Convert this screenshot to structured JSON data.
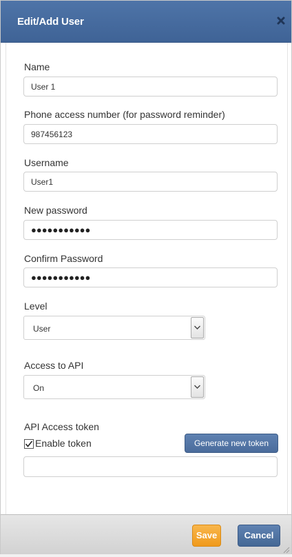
{
  "dialog": {
    "title": "Edit/Add User",
    "close_icon": "close-icon"
  },
  "form": {
    "name": {
      "label": "Name",
      "value": "User 1"
    },
    "phone": {
      "label": "Phone access number (for password reminder)",
      "value": "987456123"
    },
    "username": {
      "label": "Username",
      "value": "User1"
    },
    "new_password": {
      "label": "New password",
      "value": "●●●●●●●●●●●"
    },
    "confirm_password": {
      "label": "Confirm Password",
      "value": "●●●●●●●●●●●"
    },
    "level": {
      "label": "Level",
      "selected": "User"
    },
    "api_access": {
      "label": "Access to API",
      "selected": "On"
    },
    "api_token": {
      "label": "API Access token",
      "enable_label": "Enable token",
      "enabled": true,
      "generate_label": "Generate new token",
      "value": ""
    }
  },
  "footer": {
    "save_label": "Save",
    "cancel_label": "Cancel"
  },
  "colors": {
    "titlebar": "#456a9e",
    "primary_button": "#4b6c9c",
    "save_button": "#f4a83a"
  }
}
